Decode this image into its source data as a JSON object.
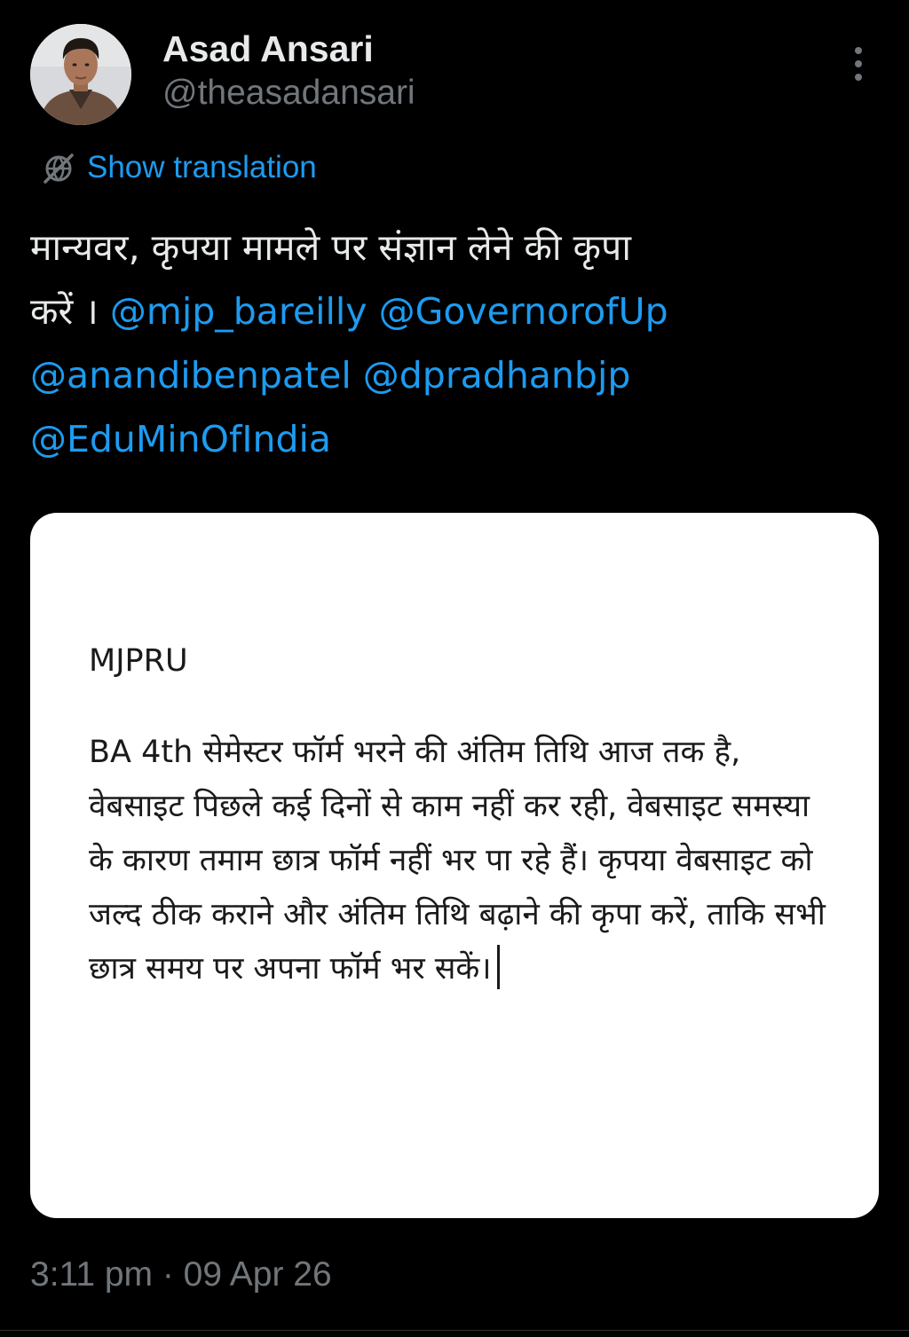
{
  "author": {
    "display_name": "Asad Ansari",
    "handle": "@theasadansari",
    "avatar_icon": "user-avatar-photo"
  },
  "header": {
    "more_icon": "vertical-ellipsis-icon"
  },
  "translation": {
    "label": "Show translation",
    "icon": "globe-translate-icon",
    "color": "#1d9bf0"
  },
  "tweet": {
    "text_line1": "मान्यवर, कृपया मामले पर संज्ञान लेने की कृपा",
    "text_line2_prefix": "करें ।",
    "mentions": [
      "@mjp_bareilly",
      "@GovernorofUp",
      "@anandibenpatel",
      "@dpradhanbjp",
      "@EduMinOfIndia"
    ],
    "mention_color": "#1d9bf0"
  },
  "media": {
    "title": "MJPRU",
    "body": "BA 4th सेमेस्टर फॉर्म भरने की अंतिम तिथि आज तक है,  वेबसाइट पिछले कई दिनों से काम नहीं कर रही, वेबसाइट समस्या के कारण तमाम छात्र फॉर्म नहीं भर पा रहे हैं। कृपया वेबसाइट को जल्द ठीक कराने और अंतिम तिथि बढ़ाने की कृपा करें, ताकि सभी छात्र समय पर अपना फॉर्म भर सकें।"
  },
  "meta": {
    "timestamp": "3:11 pm · 09 Apr 26"
  },
  "colors": {
    "background": "#000000",
    "primary_text": "#e7e9ea",
    "secondary_text": "#71767b",
    "card_background": "#ffffff"
  }
}
